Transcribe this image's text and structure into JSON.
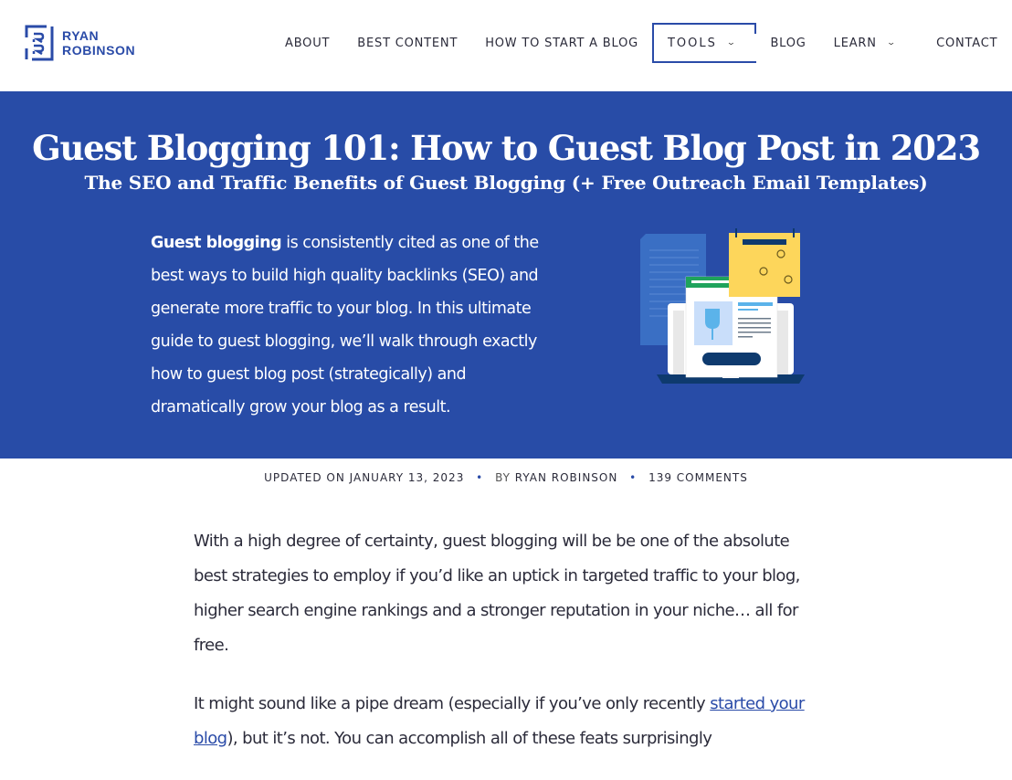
{
  "brand": {
    "name_line1": "RYAN",
    "name_line2": "ROBINSON",
    "logo_icon": "rr-monogram-icon",
    "accent_color": "#2a4ba8",
    "hero_bg_color": "#284ca7"
  },
  "nav": {
    "items": [
      {
        "label": "ABOUT",
        "has_dropdown": false,
        "active": false
      },
      {
        "label": "BEST CONTENT",
        "has_dropdown": false,
        "active": false
      },
      {
        "label": "HOW TO START A BLOG",
        "has_dropdown": false,
        "active": false
      },
      {
        "label": "TOOLS",
        "has_dropdown": true,
        "active": true
      },
      {
        "label": "BLOG",
        "has_dropdown": false,
        "active": false
      },
      {
        "label": "LEARN",
        "has_dropdown": true,
        "active": false
      },
      {
        "label": "CONTACT",
        "has_dropdown": false,
        "active": false
      }
    ],
    "dropdown_icon": "chevron-down-icon",
    "dropdown_glyph": "⌄"
  },
  "hero": {
    "title": "Guest Blogging 101: How to Guest Blog Post in 2023",
    "subtitle": "The SEO and Traffic Benefits of Guest Blogging (+ Free Outreach Email Templates)",
    "intro_bold": "Guest blogging",
    "intro_rest": " is consistently cited as one of the best ways to build high quality backlinks (SEO) and generate more traffic to your blog. In this ultimate guide to guest blogging, we’ll walk through exactly how to guest blog post (strategically) and dramatically grow your blog as a result.",
    "illustration": "laptop-blog-calendar-illustration"
  },
  "meta": {
    "updated": "UPDATED ON JANUARY 13, 2023",
    "separator": "•",
    "by_label": "BY",
    "author": "RYAN ROBINSON",
    "comments": "139 COMMENTS"
  },
  "article": {
    "p1": "With a high degree of certainty, guest blogging will be be one of the absolute best strategies to employ if you’d like an uptick in targeted traffic to your blog, higher search engine rankings and a stronger reputation in your niche… all for free.",
    "p2_before": "It might sound like a pipe dream (especially if you’ve only recently ",
    "p2_link": "started your blog",
    "p2_after": "), but it’s not. You can accomplish all of these feats surprisingly"
  }
}
